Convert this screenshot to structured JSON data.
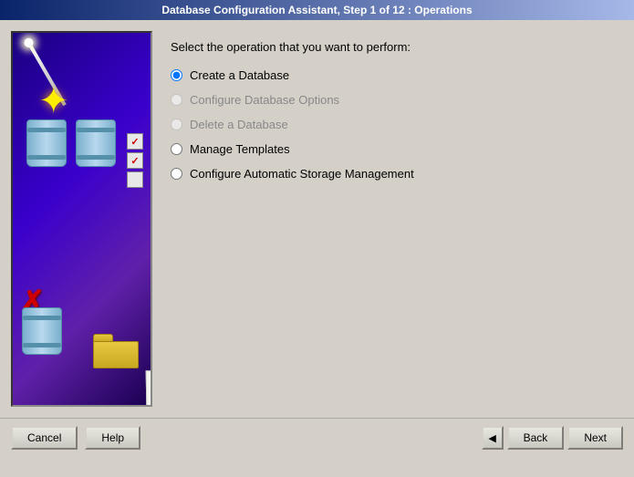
{
  "titlebar": {
    "text": "Database Configuration Assistant, Step 1 of 12 : Operations"
  },
  "instruction": {
    "text": "Select the operation that you want to perform:"
  },
  "options": [
    {
      "id": "opt1",
      "label": "Create a Database",
      "selected": true,
      "disabled": false
    },
    {
      "id": "opt2",
      "label": "Configure Database Options",
      "selected": false,
      "disabled": true
    },
    {
      "id": "opt3",
      "label": "Delete a Database",
      "selected": false,
      "disabled": true
    },
    {
      "id": "opt4",
      "label": "Manage Templates",
      "selected": false,
      "disabled": false
    },
    {
      "id": "opt5",
      "label": "Configure Automatic Storage Management",
      "selected": false,
      "disabled": false
    }
  ],
  "buttons": {
    "cancel": "Cancel",
    "help": "Help",
    "back": "Back",
    "next": "Next"
  }
}
